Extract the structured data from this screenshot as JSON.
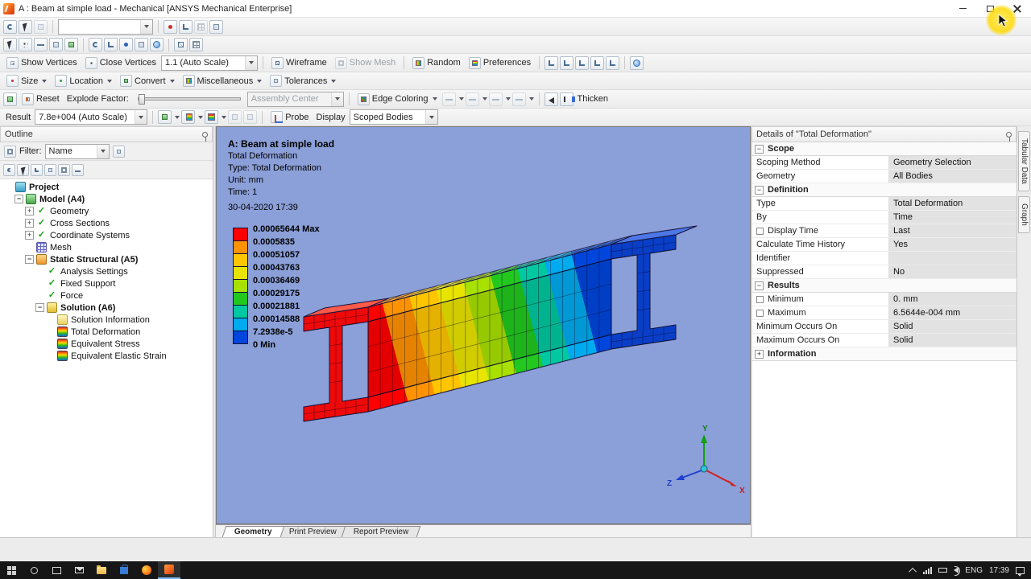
{
  "icons": {
    "expand": "+",
    "collapse": "−",
    "check": "✓"
  },
  "titlebar": {
    "title": "A : Beam at simple load - Mechanical [ANSYS Mechanical Enterprise]"
  },
  "toolbars": {
    "row3": {
      "show_vertices": "Show Vertices",
      "close_vertices": "Close Vertices",
      "scale": "1.1 (Auto Scale)",
      "wireframe": "Wireframe",
      "show_mesh": "Show Mesh",
      "random": "Random",
      "preferences": "Preferences"
    },
    "row4": {
      "size": "Size",
      "location": "Location",
      "convert": "Convert",
      "miscellaneous": "Miscellaneous",
      "tolerances": "Tolerances"
    },
    "row5": {
      "reset": "Reset",
      "explode_factor": "Explode Factor:",
      "assembly_center": "Assembly Center",
      "edge_coloring": "Edge Coloring",
      "thicken": "Thicken"
    },
    "row6": {
      "result_label": "Result",
      "result_scale": "7.8e+004 (Auto Scale)",
      "probe": "Probe",
      "display_label": "Display",
      "scoped_bodies": "Scoped Bodies"
    }
  },
  "outline": {
    "title": "Outline",
    "filter_label": "Filter:",
    "filter_value": "Name",
    "tree": [
      {
        "id": "project",
        "label": "Project",
        "depth": 0,
        "exp": null,
        "icon": "ico-project",
        "bold": true
      },
      {
        "id": "model-a4",
        "label": "Model (A4)",
        "depth": 1,
        "exp": "-",
        "icon": "ico-model",
        "bold": true
      },
      {
        "id": "geometry",
        "label": "Geometry",
        "depth": 2,
        "exp": "+",
        "icon": "ico-check",
        "bold": false
      },
      {
        "id": "cross-sections",
        "label": "Cross Sections",
        "depth": 2,
        "exp": "+",
        "icon": "ico-check",
        "bold": false
      },
      {
        "id": "coordinate-systems",
        "label": "Coordinate Systems",
        "depth": 2,
        "exp": "+",
        "icon": "ico-check",
        "bold": false
      },
      {
        "id": "mesh",
        "label": "Mesh",
        "depth": 2,
        "exp": null,
        "icon": "ico-mesh",
        "bold": false
      },
      {
        "id": "static-structural-a5",
        "label": "Static Structural (A5)",
        "depth": 2,
        "exp": "-",
        "icon": "ico-system",
        "bold": true
      },
      {
        "id": "analysis-settings",
        "label": "Analysis Settings",
        "depth": 3,
        "exp": null,
        "icon": "ico-check",
        "bold": false
      },
      {
        "id": "fixed-support",
        "label": "Fixed Support",
        "depth": 3,
        "exp": null,
        "icon": "ico-check",
        "bold": false
      },
      {
        "id": "force",
        "label": "Force",
        "depth": 3,
        "exp": null,
        "icon": "ico-check",
        "bold": false
      },
      {
        "id": "solution-a6",
        "label": "Solution (A6)",
        "depth": 3,
        "exp": "-",
        "icon": "ico-solution",
        "bold": true
      },
      {
        "id": "solution-information",
        "label": "Solution Information",
        "depth": 4,
        "exp": null,
        "icon": "ico-solinfo",
        "bold": false
      },
      {
        "id": "total-deformation",
        "label": "Total Deformation",
        "depth": 4,
        "exp": null,
        "icon": "ico-result",
        "bold": false
      },
      {
        "id": "equivalent-stress",
        "label": "Equivalent Stress",
        "depth": 4,
        "exp": null,
        "icon": "ico-result",
        "bold": false
      },
      {
        "id": "equivalent-elastic-strain",
        "label": "Equivalent Elastic Strain",
        "depth": 4,
        "exp": null,
        "icon": "ico-result",
        "bold": false
      }
    ]
  },
  "viewport": {
    "annotations": {
      "title": "A: Beam at simple load",
      "lines": [
        "Total Deformation",
        "Type: Total Deformation",
        "Unit: mm",
        "Time: 1"
      ],
      "date": "30-04-2020 17:39"
    },
    "legend": {
      "labels": [
        "0.00065644 Max",
        "0.0005835",
        "0.00051057",
        "0.00043763",
        "0.00036469",
        "0.00029175",
        "0.00021881",
        "0.00014588",
        "7.2938e-5",
        "0 Min"
      ],
      "colors": [
        "#ff0000",
        "#ff9200",
        "#ffc600",
        "#e8e400",
        "#a8e000",
        "#22c81e",
        "#00c8a0",
        "#00aaee",
        "#0046dc"
      ]
    },
    "triad": {
      "x": "X",
      "y": "Y",
      "z": "Z"
    },
    "tabs": [
      {
        "label": "Geometry",
        "active": true
      },
      {
        "label": "Print Preview",
        "active": false
      },
      {
        "label": "Report Preview",
        "active": false
      }
    ]
  },
  "details": {
    "title": "Details of \"Total Deformation\"",
    "sections": [
      {
        "label": "Scope",
        "collapsed": false,
        "rows": [
          {
            "label": "Scoping Method",
            "value": "Geometry Selection",
            "checkbox": false
          },
          {
            "label": "Geometry",
            "value": "All Bodies",
            "checkbox": false
          }
        ]
      },
      {
        "label": "Definition",
        "collapsed": false,
        "rows": [
          {
            "label": "Type",
            "value": "Total Deformation",
            "checkbox": false
          },
          {
            "label": "By",
            "value": "Time",
            "checkbox": false
          },
          {
            "label": "Display Time",
            "value": "Last",
            "checkbox": true
          },
          {
            "label": "Calculate Time History",
            "value": "Yes",
            "checkbox": false
          },
          {
            "label": "Identifier",
            "value": "",
            "checkbox": false
          },
          {
            "label": "Suppressed",
            "value": "No",
            "checkbox": false
          }
        ]
      },
      {
        "label": "Results",
        "collapsed": false,
        "rows": [
          {
            "label": "Minimum",
            "value": "0. mm",
            "checkbox": true
          },
          {
            "label": "Maximum",
            "value": "6.5644e-004 mm",
            "checkbox": true
          },
          {
            "label": "Minimum Occurs On",
            "value": "Solid",
            "checkbox": false
          },
          {
            "label": "Maximum Occurs On",
            "value": "Solid",
            "checkbox": false
          }
        ]
      },
      {
        "label": "Information",
        "collapsed": true,
        "rows": []
      }
    ]
  },
  "side_tabs": [
    "Tabular Data",
    "Graph"
  ],
  "taskbar": {
    "language": "ENG",
    "time": "17:39"
  }
}
